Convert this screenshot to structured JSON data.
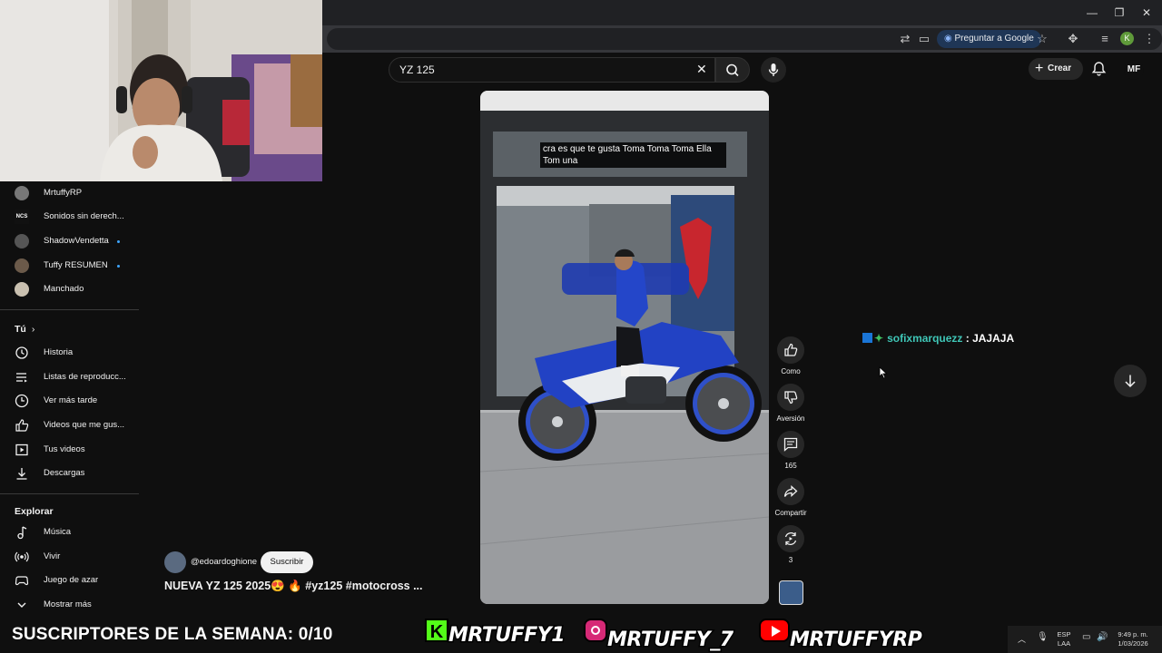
{
  "browser": {
    "google_button_label": "Preguntar a Google",
    "profile_initial": "K"
  },
  "header": {
    "search_value": "YZ 125",
    "create_label": "Crear",
    "account_initials": "MF"
  },
  "sidebar": {
    "subscriptions": [
      {
        "label": "MrtuffyRP",
        "dot": false
      },
      {
        "label": "Sonidos sin derech...",
        "dot": false
      },
      {
        "label": "ShadowVendetta",
        "dot": true
      },
      {
        "label": "Tuffy RESUMEN",
        "dot": true
      },
      {
        "label": "Manchado",
        "dot": false
      }
    ],
    "you_heading": "Tú",
    "you_items": [
      {
        "label": "Historia",
        "icon": "history-icon"
      },
      {
        "label": "Listas de reproducc...",
        "icon": "playlists-icon"
      },
      {
        "label": "Ver más tarde",
        "icon": "watch-later-icon"
      },
      {
        "label": "Videos que me gus...",
        "icon": "liked-videos-icon"
      },
      {
        "label": "Tus videos",
        "icon": "your-videos-icon"
      },
      {
        "label": "Descargas",
        "icon": "downloads-icon"
      }
    ],
    "explore_heading": "Explorar",
    "explore_items": [
      {
        "label": "Música",
        "icon": "music-icon"
      },
      {
        "label": "Vivir",
        "icon": "live-icon"
      },
      {
        "label": "Juego de azar",
        "icon": "gaming-icon"
      },
      {
        "label": "Mostrar más",
        "icon": "chevron-down-icon"
      }
    ]
  },
  "short": {
    "caption": "cra es que te gusta Toma Toma Toma Ella Tom una",
    "channel": "@edoardoghione",
    "subscribe_label": "Suscribir",
    "title": "NUEVA YZ 125 2025😍 🔥 #yz125  #motocross ...",
    "actions": {
      "like_label": "Como",
      "dislike_label": "Aversión",
      "comments_count": "165",
      "share_label": "Compartir",
      "remix_count": "3"
    }
  },
  "chat": {
    "username": "sofixmarquezz",
    "message": " : JAJAJA",
    "username_color": "#3fc6b7"
  },
  "overlay": {
    "subs_banner": "SUSCRIPTORES DE LA SEMANA: 0/10",
    "kick": "MRTUFFY1",
    "instagram": "MRTUFFY_7",
    "youtube": "MRTUFFYRP"
  },
  "taskbar": {
    "lang_line1": "ESP",
    "lang_line2": "LAA",
    "time": "9:49 p. m.",
    "date": "1/03/2026"
  }
}
